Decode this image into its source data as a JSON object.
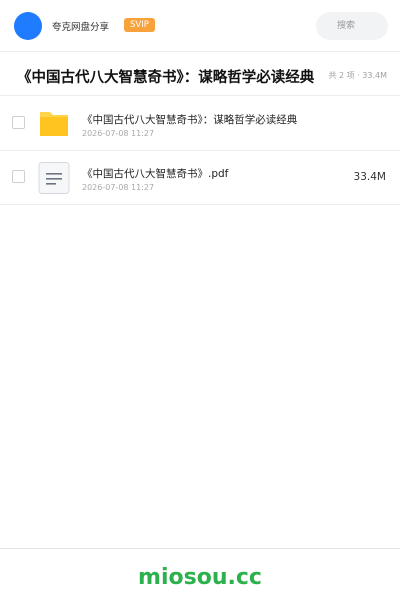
{
  "header": {
    "brand": "夸克网盘分享",
    "badge": "SVIP",
    "search_placeholder": "搜索"
  },
  "folder": {
    "title": "《中国古代八大智慧奇书》：谋略哲学必读经典",
    "meta": "共 2 项 · 33.4M"
  },
  "files": [
    {
      "icon": "folder-icon",
      "name": "《中国古代八大智慧奇书》：谋略哲学必读经典",
      "date": "2026-07-08 11:27",
      "size": ""
    },
    {
      "icon": "document-icon",
      "name": "《中国古代八大智慧奇书》.pdf",
      "date": "2026-07-08 11:27",
      "size": "33.4M"
    }
  ],
  "footer": {
    "watermark": "miosou.cc"
  },
  "colors": {
    "accent": "#1f7cff",
    "badge": "#f7a23a",
    "folder": "#ffc41f",
    "watermark": "#2db14d"
  }
}
